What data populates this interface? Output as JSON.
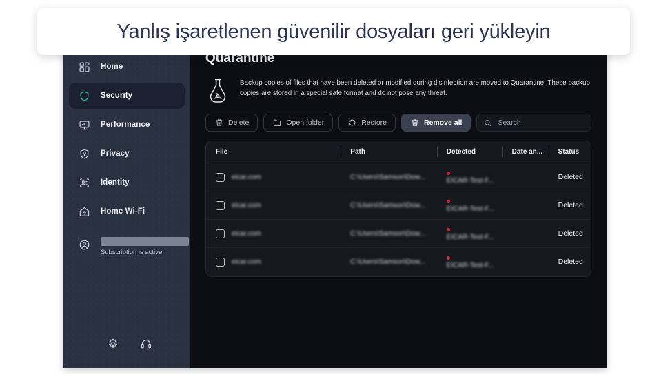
{
  "banner": {
    "text": "Yanlış işaretlenen güvenilir dosyaları geri yükleyin"
  },
  "sidebar": {
    "items": [
      {
        "label": "Home",
        "icon": "grid-dashboard-icon",
        "active": false
      },
      {
        "label": "Security",
        "icon": "shield-icon",
        "active": true
      },
      {
        "label": "Performance",
        "icon": "monitor-icon",
        "active": false
      },
      {
        "label": "Privacy",
        "icon": "privacy-shield-icon",
        "active": false
      },
      {
        "label": "Identity",
        "icon": "id-card-icon",
        "active": false
      },
      {
        "label": "Home Wi-Fi",
        "icon": "home-wifi-icon",
        "active": false
      }
    ],
    "subscription": {
      "icon": "user-account-icon",
      "account_name": "",
      "status": "Subscription is active"
    },
    "footer": [
      {
        "icon": "gear-icon",
        "label": "Settings"
      },
      {
        "icon": "headset-icon",
        "label": "Support"
      }
    ]
  },
  "main": {
    "page_title": "Quarantine",
    "info": {
      "icon": "flask-biohazard-icon",
      "text": "Backup copies of files that have been deleted or modified during disinfection are moved to Quarantine. These backup copies are stored in a special safe format and do not pose any threat."
    },
    "toolbar": {
      "delete_label": "Delete",
      "open_folder_label": "Open folder",
      "restore_label": "Restore",
      "remove_all_label": "Remove all",
      "search_placeholder": "Search",
      "search_value": ""
    },
    "table": {
      "columns": [
        "File",
        "Path",
        "Detected",
        "Date an...",
        "Status"
      ],
      "rows": [
        {
          "file": "eicar.com",
          "path": "C:\\Users\\Samson\\Dow...",
          "detected": "EICAR-Test-F...",
          "date": "",
          "status": "Deleted"
        },
        {
          "file": "eicar.com",
          "path": "C:\\Users\\Samson\\Dow...",
          "detected": "EICAR-Test-F...",
          "date": "",
          "status": "Deleted"
        },
        {
          "file": "eicar.com",
          "path": "C:\\Users\\Samson\\Dow...",
          "detected": "EICAR-Test-F...",
          "date": "",
          "status": "Deleted"
        },
        {
          "file": "eicar.com",
          "path": "C:\\Users\\Samson\\Dow...",
          "detected": "EICAR-Test-F...",
          "date": "",
          "status": "Deleted"
        }
      ]
    }
  },
  "colors": {
    "sidebar_bg": "#2a3141",
    "main_bg": "#0d0e14",
    "accent_green": "#2fb78b",
    "threat_red": "#d32f3a",
    "banner_text": "#2e3457"
  }
}
